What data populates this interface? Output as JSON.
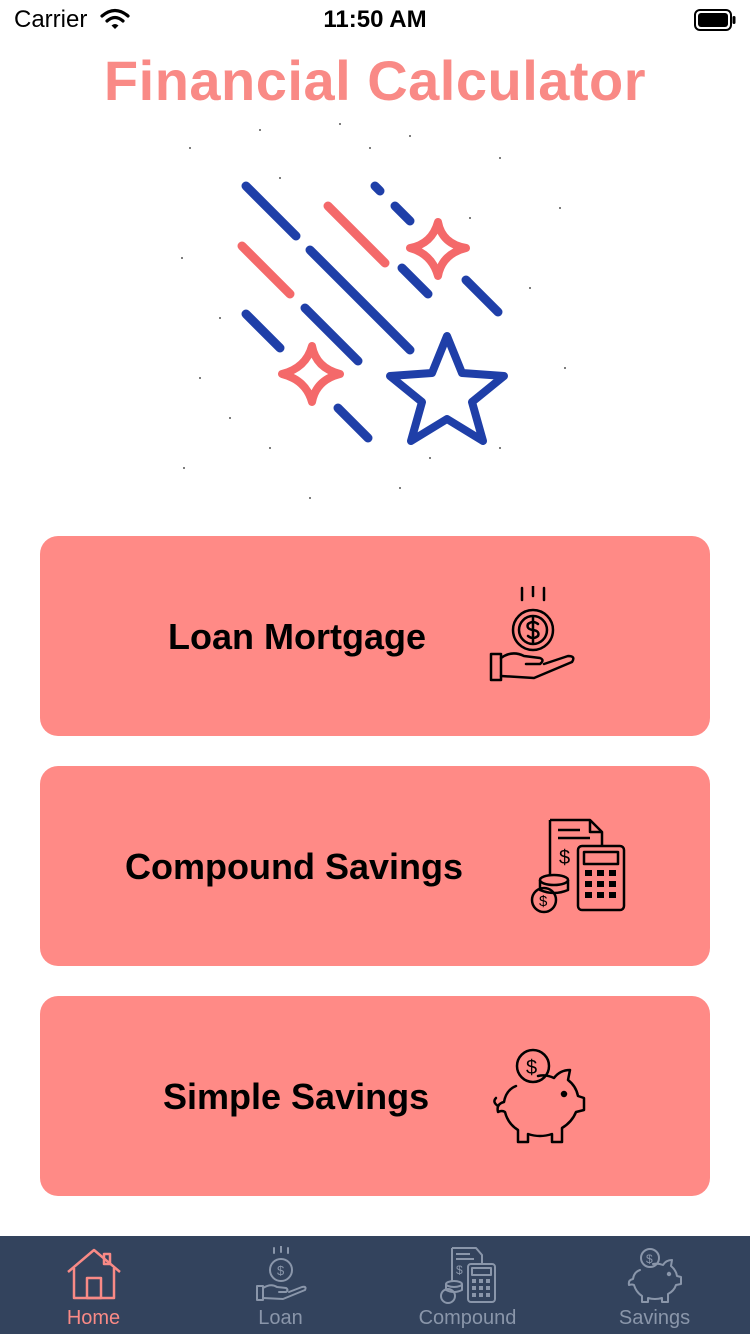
{
  "status_bar": {
    "carrier": "Carrier",
    "time": "11:50 AM"
  },
  "app": {
    "title": "Financial Calculator"
  },
  "hero": {
    "icon": "shooting-stars-illustration"
  },
  "cards": [
    {
      "label": "Loan Mortgage",
      "icon": "money-hand-icon"
    },
    {
      "label": "Compound Savings",
      "icon": "calculator-coins-icon"
    },
    {
      "label": "Simple Savings",
      "icon": "piggy-bank-icon"
    }
  ],
  "tabs": [
    {
      "label": "Home",
      "icon": "house-icon",
      "active": true
    },
    {
      "label": "Loan",
      "icon": "money-hand-icon",
      "active": false
    },
    {
      "label": "Compound",
      "icon": "calculator-coins-icon",
      "active": false
    },
    {
      "label": "Savings",
      "icon": "piggy-bank-icon",
      "active": false
    }
  ],
  "colors": {
    "accent": "#f98a86",
    "card_bg": "#ff8a86",
    "tabbar_bg": "#33435d",
    "inactive_tab": "#8a96aa",
    "illustration_blue": "#1f3fa8",
    "illustration_red": "#f4696a"
  }
}
